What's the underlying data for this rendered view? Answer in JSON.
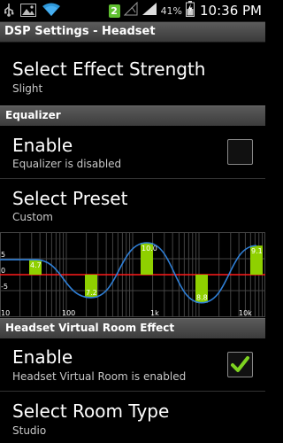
{
  "status_bar": {
    "notification_count": "2",
    "battery_percent": "41%",
    "time": "10:36 PM",
    "icons": [
      "usb-icon",
      "image-icon",
      "wifi-icon",
      "notification-count-badge",
      "signal-off-icon",
      "signal-icon",
      "battery-charging-icon"
    ]
  },
  "titlebar": {
    "title": "DSP Settings - Headset"
  },
  "effect_strength": {
    "title": "Select Effect Strength",
    "summary": "Slight"
  },
  "equalizer_section": {
    "header": "Equalizer"
  },
  "eq_enable": {
    "title": "Enable",
    "summary": "Equalizer is disabled",
    "checked": false
  },
  "eq_preset": {
    "title": "Select Preset",
    "summary": "Custom"
  },
  "eq_graph": {
    "y_ticks": [
      "5",
      "0",
      "-5"
    ],
    "x_ticks": [
      "10",
      "100",
      "1k",
      "10k"
    ],
    "bands": [
      {
        "label": "4.7",
        "value": 4.7
      },
      {
        "label": "7.2",
        "value": -7.2
      },
      {
        "label": "10.0",
        "value": 10.0
      },
      {
        "label": "8.8",
        "value": -8.8
      },
      {
        "label": "9.1",
        "value": 9.1
      }
    ],
    "colors": {
      "bar": "#8fd000",
      "curve": "#2f7fd6",
      "zero_line": "#ff1a1a",
      "grid": "#444444"
    }
  },
  "room_section": {
    "header": "Headset Virtual Room Effect"
  },
  "room_enable": {
    "title": "Enable",
    "summary": "Headset Virtual Room is enabled",
    "checked": true
  },
  "room_type": {
    "title": "Select Room Type",
    "summary": "Studio"
  }
}
